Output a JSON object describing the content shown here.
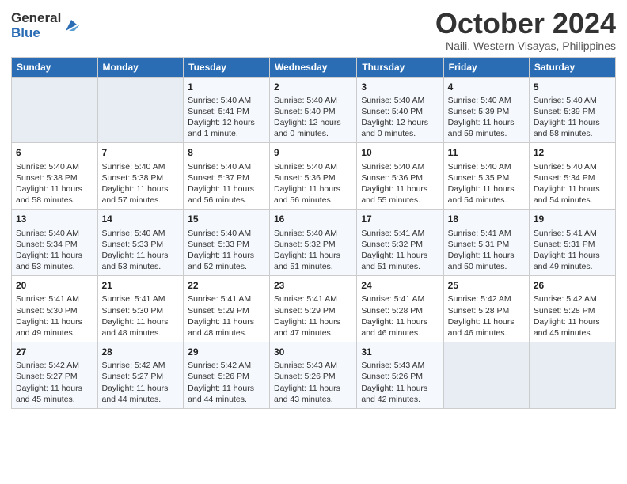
{
  "logo": {
    "general": "General",
    "blue": "Blue"
  },
  "header": {
    "month": "October 2024",
    "location": "Naili, Western Visayas, Philippines"
  },
  "weekdays": [
    "Sunday",
    "Monday",
    "Tuesday",
    "Wednesday",
    "Thursday",
    "Friday",
    "Saturday"
  ],
  "weeks": [
    [
      {
        "day": "",
        "content": ""
      },
      {
        "day": "",
        "content": ""
      },
      {
        "day": "1",
        "content": "Sunrise: 5:40 AM\nSunset: 5:41 PM\nDaylight: 12 hours and 1 minute."
      },
      {
        "day": "2",
        "content": "Sunrise: 5:40 AM\nSunset: 5:40 PM\nDaylight: 12 hours and 0 minutes."
      },
      {
        "day": "3",
        "content": "Sunrise: 5:40 AM\nSunset: 5:40 PM\nDaylight: 12 hours and 0 minutes."
      },
      {
        "day": "4",
        "content": "Sunrise: 5:40 AM\nSunset: 5:39 PM\nDaylight: 11 hours and 59 minutes."
      },
      {
        "day": "5",
        "content": "Sunrise: 5:40 AM\nSunset: 5:39 PM\nDaylight: 11 hours and 58 minutes."
      }
    ],
    [
      {
        "day": "6",
        "content": "Sunrise: 5:40 AM\nSunset: 5:38 PM\nDaylight: 11 hours and 58 minutes."
      },
      {
        "day": "7",
        "content": "Sunrise: 5:40 AM\nSunset: 5:38 PM\nDaylight: 11 hours and 57 minutes."
      },
      {
        "day": "8",
        "content": "Sunrise: 5:40 AM\nSunset: 5:37 PM\nDaylight: 11 hours and 56 minutes."
      },
      {
        "day": "9",
        "content": "Sunrise: 5:40 AM\nSunset: 5:36 PM\nDaylight: 11 hours and 56 minutes."
      },
      {
        "day": "10",
        "content": "Sunrise: 5:40 AM\nSunset: 5:36 PM\nDaylight: 11 hours and 55 minutes."
      },
      {
        "day": "11",
        "content": "Sunrise: 5:40 AM\nSunset: 5:35 PM\nDaylight: 11 hours and 54 minutes."
      },
      {
        "day": "12",
        "content": "Sunrise: 5:40 AM\nSunset: 5:34 PM\nDaylight: 11 hours and 54 minutes."
      }
    ],
    [
      {
        "day": "13",
        "content": "Sunrise: 5:40 AM\nSunset: 5:34 PM\nDaylight: 11 hours and 53 minutes."
      },
      {
        "day": "14",
        "content": "Sunrise: 5:40 AM\nSunset: 5:33 PM\nDaylight: 11 hours and 53 minutes."
      },
      {
        "day": "15",
        "content": "Sunrise: 5:40 AM\nSunset: 5:33 PM\nDaylight: 11 hours and 52 minutes."
      },
      {
        "day": "16",
        "content": "Sunrise: 5:40 AM\nSunset: 5:32 PM\nDaylight: 11 hours and 51 minutes."
      },
      {
        "day": "17",
        "content": "Sunrise: 5:41 AM\nSunset: 5:32 PM\nDaylight: 11 hours and 51 minutes."
      },
      {
        "day": "18",
        "content": "Sunrise: 5:41 AM\nSunset: 5:31 PM\nDaylight: 11 hours and 50 minutes."
      },
      {
        "day": "19",
        "content": "Sunrise: 5:41 AM\nSunset: 5:31 PM\nDaylight: 11 hours and 49 minutes."
      }
    ],
    [
      {
        "day": "20",
        "content": "Sunrise: 5:41 AM\nSunset: 5:30 PM\nDaylight: 11 hours and 49 minutes."
      },
      {
        "day": "21",
        "content": "Sunrise: 5:41 AM\nSunset: 5:30 PM\nDaylight: 11 hours and 48 minutes."
      },
      {
        "day": "22",
        "content": "Sunrise: 5:41 AM\nSunset: 5:29 PM\nDaylight: 11 hours and 48 minutes."
      },
      {
        "day": "23",
        "content": "Sunrise: 5:41 AM\nSunset: 5:29 PM\nDaylight: 11 hours and 47 minutes."
      },
      {
        "day": "24",
        "content": "Sunrise: 5:41 AM\nSunset: 5:28 PM\nDaylight: 11 hours and 46 minutes."
      },
      {
        "day": "25",
        "content": "Sunrise: 5:42 AM\nSunset: 5:28 PM\nDaylight: 11 hours and 46 minutes."
      },
      {
        "day": "26",
        "content": "Sunrise: 5:42 AM\nSunset: 5:28 PM\nDaylight: 11 hours and 45 minutes."
      }
    ],
    [
      {
        "day": "27",
        "content": "Sunrise: 5:42 AM\nSunset: 5:27 PM\nDaylight: 11 hours and 45 minutes."
      },
      {
        "day": "28",
        "content": "Sunrise: 5:42 AM\nSunset: 5:27 PM\nDaylight: 11 hours and 44 minutes."
      },
      {
        "day": "29",
        "content": "Sunrise: 5:42 AM\nSunset: 5:26 PM\nDaylight: 11 hours and 44 minutes."
      },
      {
        "day": "30",
        "content": "Sunrise: 5:43 AM\nSunset: 5:26 PM\nDaylight: 11 hours and 43 minutes."
      },
      {
        "day": "31",
        "content": "Sunrise: 5:43 AM\nSunset: 5:26 PM\nDaylight: 11 hours and 42 minutes."
      },
      {
        "day": "",
        "content": ""
      },
      {
        "day": "",
        "content": ""
      }
    ]
  ]
}
